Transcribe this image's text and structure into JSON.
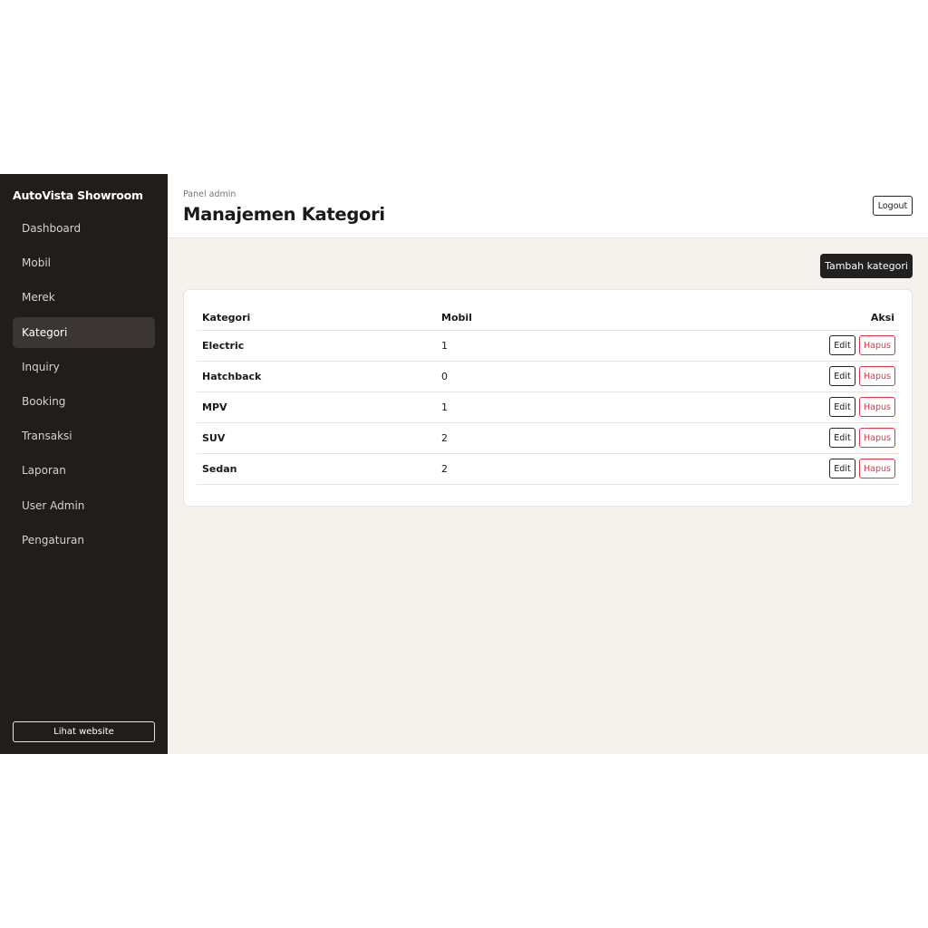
{
  "sidebar": {
    "brand": "AutoVista Showroom",
    "items": [
      {
        "label": "Dashboard"
      },
      {
        "label": "Mobil"
      },
      {
        "label": "Merek"
      },
      {
        "label": "Kategori",
        "active": true
      },
      {
        "label": "Inquiry"
      },
      {
        "label": "Booking"
      },
      {
        "label": "Transaksi"
      },
      {
        "label": "Laporan"
      },
      {
        "label": "User Admin"
      },
      {
        "label": "Pengaturan"
      }
    ],
    "view_site_label": "Lihat website"
  },
  "header": {
    "breadcrumb": "Panel admin",
    "title": "Manajemen Kategori",
    "logout_label": "Logout"
  },
  "toolbar": {
    "add_label": "Tambah kategori"
  },
  "table": {
    "columns": [
      "Kategori",
      "Mobil",
      "Aksi"
    ],
    "rows": [
      {
        "name": "Electric",
        "count": "1"
      },
      {
        "name": "Hatchback",
        "count": "0"
      },
      {
        "name": "MPV",
        "count": "1"
      },
      {
        "name": "SUV",
        "count": "2"
      },
      {
        "name": "Sedan",
        "count": "2"
      }
    ],
    "edit_label": "Edit",
    "delete_label": "Hapus"
  },
  "colors": {
    "sidebar_bg": "#211d1a",
    "main_bg": "#f5f2ed",
    "danger": "#dc3b4a"
  }
}
